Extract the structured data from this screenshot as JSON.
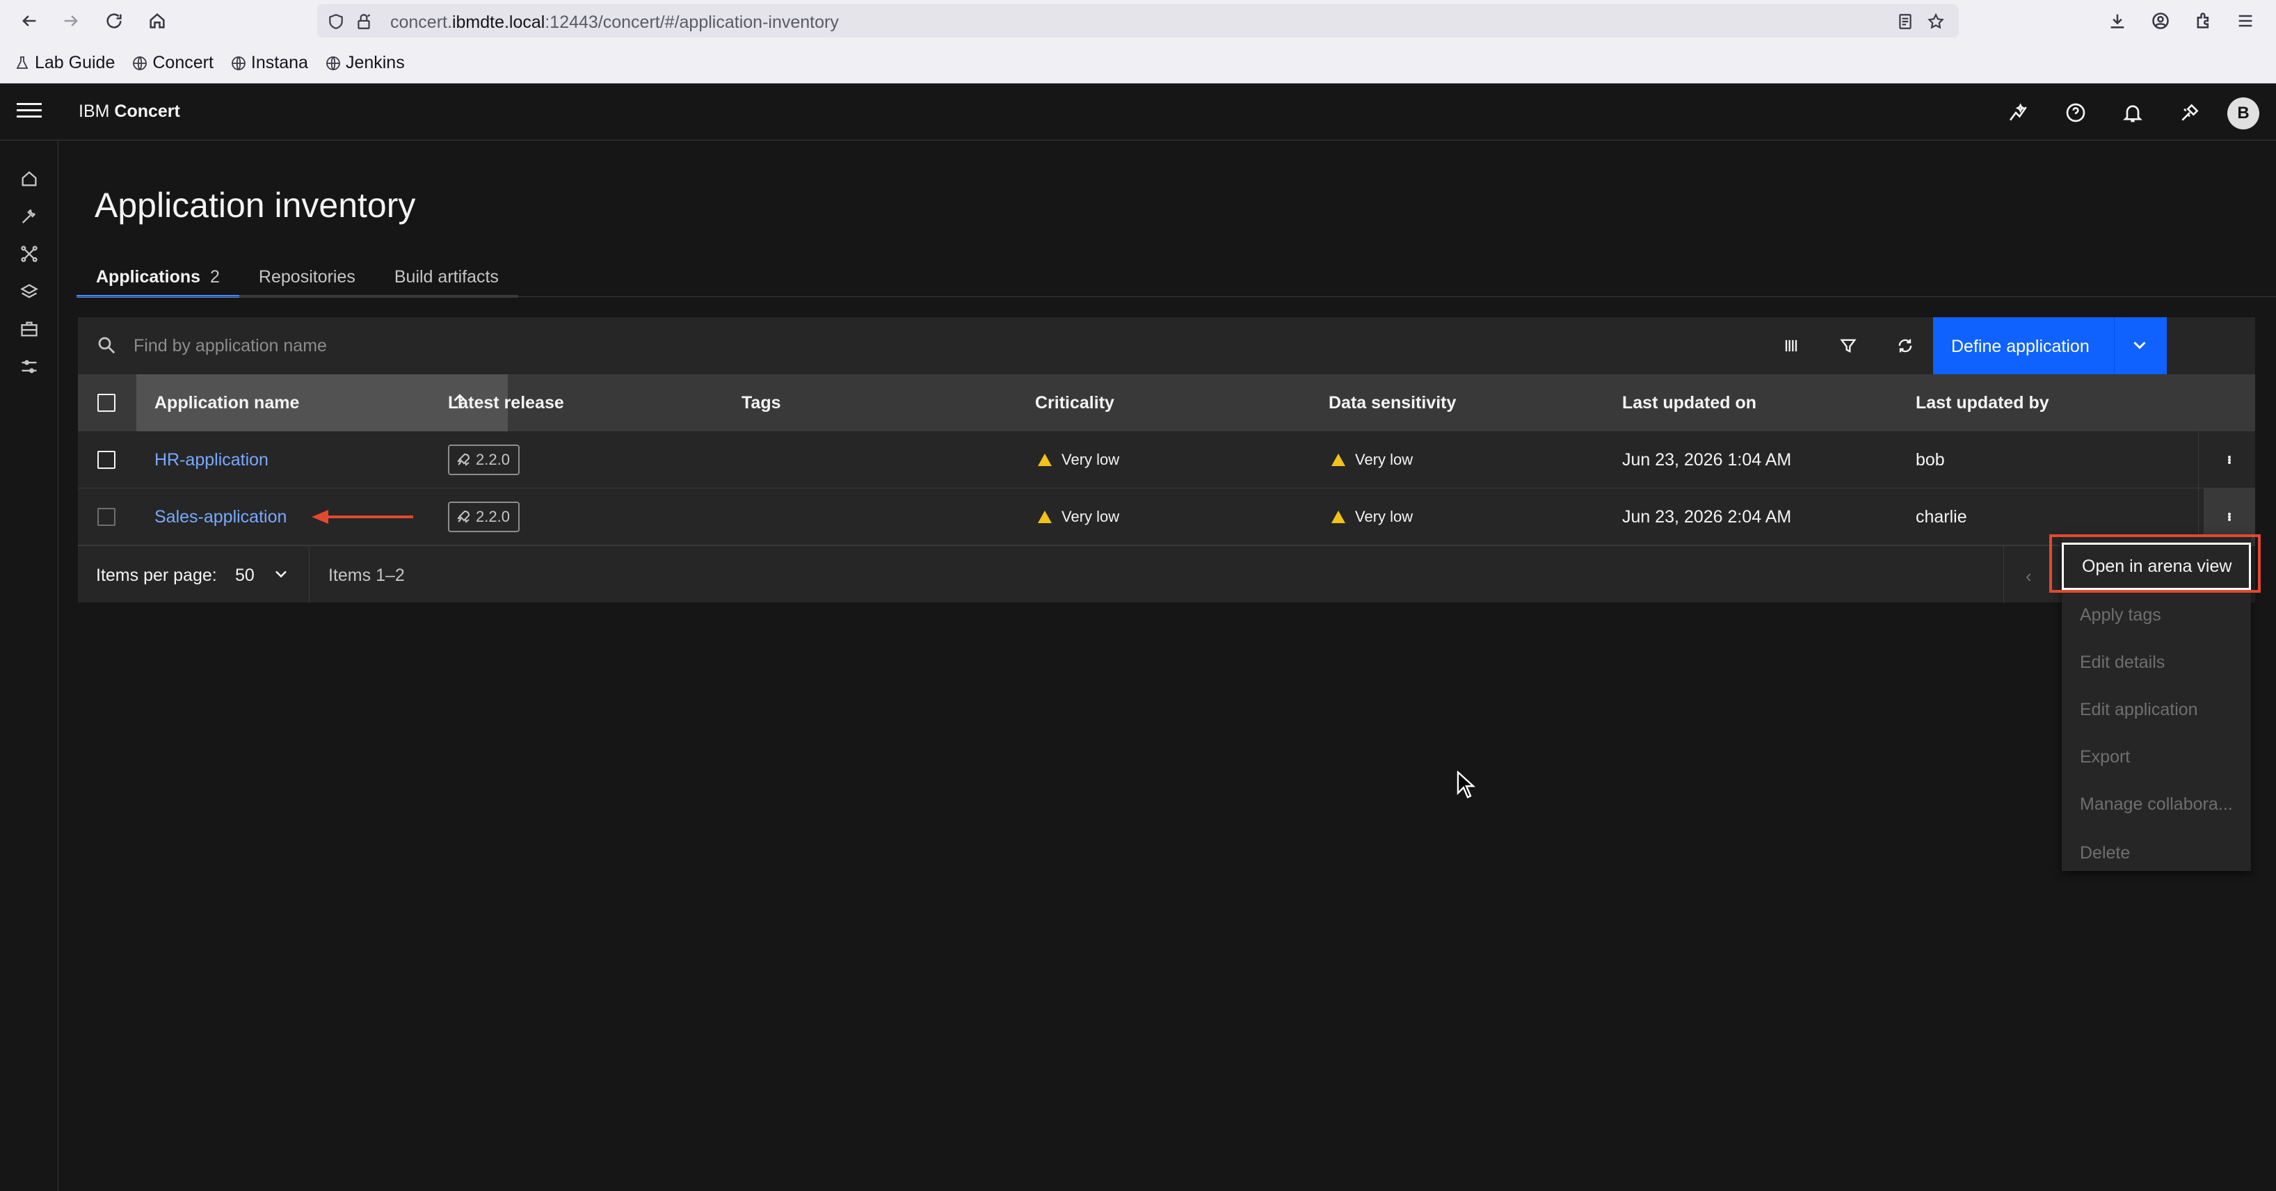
{
  "browser": {
    "url_host": "concert.ibmdte.local",
    "url_rest": ":12443/concert/#/application-inventory",
    "url_prefix": "concert.",
    "url_domain": "ibmdte.local",
    "bookmarks": [
      {
        "label": "Lab Guide",
        "icon": "lab-icon"
      },
      {
        "label": "Concert",
        "icon": "globe-icon"
      },
      {
        "label": "Instana",
        "icon": "globe-icon"
      },
      {
        "label": "Jenkins",
        "icon": "globe-icon"
      }
    ]
  },
  "header": {
    "brand_prefix": "IBM ",
    "brand_name": "Concert",
    "avatar_initial": "B"
  },
  "page": {
    "title": "Application inventory",
    "tabs": [
      {
        "label": "Applications",
        "count": "2",
        "active": true
      },
      {
        "label": "Repositories"
      },
      {
        "label": "Build artifacts"
      }
    ]
  },
  "toolbar": {
    "search_placeholder": "Find by application name",
    "define_button": "Define application"
  },
  "table": {
    "columns": [
      "Application name",
      "Latest release",
      "Tags",
      "Criticality",
      "Data sensitivity",
      "Last updated on",
      "Last updated by"
    ],
    "rows": [
      {
        "name": "HR-application",
        "release": "2.2.0",
        "tags": "",
        "criticality": "Very low",
        "sensitivity": "Very low",
        "updated_on": "Jun 23, 2026 1:04 AM",
        "updated_by": "bob"
      },
      {
        "name": "Sales-application",
        "release": "2.2.0",
        "tags": "",
        "criticality": "Very low",
        "sensitivity": "Very low",
        "updated_on": "Jun 23, 2026 2:04 AM",
        "updated_by": "charlie"
      }
    ]
  },
  "pagination": {
    "items_per_page_label": "Items per page:",
    "items_per_page_value": "50",
    "items_range": "Items 1–2",
    "prev_glyph": "‹"
  },
  "overflow_menu": {
    "items": [
      {
        "label": "Open in arena view",
        "enabled": true
      },
      {
        "label": "Apply tags",
        "enabled": false
      },
      {
        "label": "Edit details",
        "enabled": false
      },
      {
        "label": "Edit application",
        "enabled": false
      },
      {
        "label": "Export",
        "enabled": false
      },
      {
        "label": "Manage collabora...",
        "enabled": false
      },
      {
        "label": "Delete",
        "enabled": false
      }
    ]
  },
  "colors": {
    "accent": "#0f62fe",
    "link": "#78a9ff",
    "warning": "#f1c21b",
    "annotation": "#e04a2f"
  }
}
